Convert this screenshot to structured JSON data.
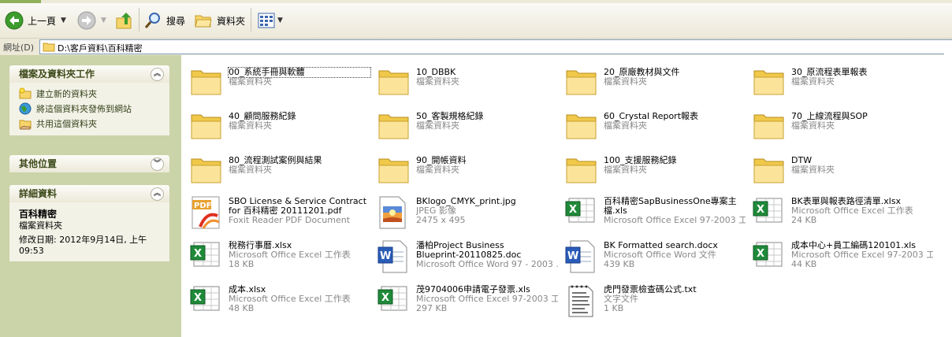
{
  "toolbar": {
    "back_label": "上一頁",
    "search_label": "搜尋",
    "folders_label": "資料夾"
  },
  "address": {
    "label": "網址(D)",
    "path": "D:\\客戶資料\\百科精密"
  },
  "left_pane": {
    "tasks_panel": {
      "title": "檔案及資料夾工作",
      "items": [
        "建立新的資料夾",
        "將這個資料夾發佈到網站",
        "共用這個資料夾"
      ]
    },
    "other_places": {
      "title": "其他位置"
    },
    "details": {
      "title": "詳細資料",
      "name": "百科精密",
      "type": "檔案資料夾",
      "modified": "修改日期: 2012年9月14日, 上午 09:53"
    }
  },
  "files": [
    {
      "name": "00_系統手冊與軟體",
      "line2": "檔案資料夾",
      "line3": "",
      "icon": "folder-icon"
    },
    {
      "name": "10_DBBK",
      "line2": "檔案資料夾",
      "line3": "",
      "icon": "folder-icon"
    },
    {
      "name": "20_原廠教材與文件",
      "line2": "檔案資料夾",
      "line3": "",
      "icon": "folder-icon"
    },
    {
      "name": "30_原流程表單報表",
      "line2": "檔案資料夾",
      "line3": "",
      "icon": "folder-icon"
    },
    {
      "name": "40_顧問服務紀錄",
      "line2": "檔案資料夾",
      "line3": "",
      "icon": "folder-icon"
    },
    {
      "name": "50_客製規格紀錄",
      "line2": "檔案資料夾",
      "line3": "",
      "icon": "folder-icon"
    },
    {
      "name": "60_Crystal Report報表",
      "line2": "檔案資料夾",
      "line3": "",
      "icon": "folder-icon"
    },
    {
      "name": "70_上線流程與SOP",
      "line2": "檔案資料夾",
      "line3": "",
      "icon": "folder-icon"
    },
    {
      "name": "80_流程測試案例與結果",
      "line2": "檔案資料夾",
      "line3": "",
      "icon": "folder-icon"
    },
    {
      "name": "90_開帳資料",
      "line2": "檔案資料夾",
      "line3": "",
      "icon": "folder-icon"
    },
    {
      "name": "100_支援服務紀錄",
      "line2": "檔案資料夾",
      "line3": "",
      "icon": "folder-icon"
    },
    {
      "name": "DTW",
      "line2": "檔案資料夾",
      "line3": "",
      "icon": "folder-icon"
    },
    {
      "name": "SBO License & Service Contract for 百科精密 20111201.pdf",
      "line2": "Foxit Reader PDF Document",
      "line3": "",
      "icon": "pdf-icon"
    },
    {
      "name": "BKlogo_CMYK_print.jpg",
      "line2": "JPEG 影像",
      "line3": "2475 x 495",
      "icon": "image-icon"
    },
    {
      "name": "百科精密SapBusinessOne專案主檔.xls",
      "line2": "Microsoft Office Excel 97-2003 工...",
      "line3": "",
      "icon": "excel-icon"
    },
    {
      "name": "BK表單與報表路徑清單.xlsx",
      "line2": "Microsoft Office Excel 工作表",
      "line3": "24 KB",
      "icon": "excel-icon"
    },
    {
      "name": "稅務行事曆.xlsx",
      "line2": "Microsoft Office Excel 工作表",
      "line3": "18 KB",
      "icon": "excel-icon"
    },
    {
      "name": "潘柏Project Business Blueprint-20110825.doc",
      "line2": "Microsoft Office Word 97 - 2003 ...",
      "line3": "",
      "icon": "word-icon"
    },
    {
      "name": "BK Formatted search.docx",
      "line2": "Microsoft Office Word 文件",
      "line3": "439 KB",
      "icon": "word-icon"
    },
    {
      "name": "成本中心+員工編碼120101.xls",
      "line2": "Microsoft Office Excel 97-2003 工...",
      "line3": "44 KB",
      "icon": "excel-icon"
    },
    {
      "name": "成本.xlsx",
      "line2": "Microsoft Office Excel 工作表",
      "line3": "48 KB",
      "icon": "excel-icon"
    },
    {
      "name": "茂9704006申請電子發票.xls",
      "line2": "Microsoft Office Excel 97-2003 工...",
      "line3": "297 KB",
      "icon": "excel-icon"
    },
    {
      "name": "虎門發票檢查碼公式.txt",
      "line2": "文字文件",
      "line3": "1 KB",
      "icon": "text-icon"
    }
  ]
}
